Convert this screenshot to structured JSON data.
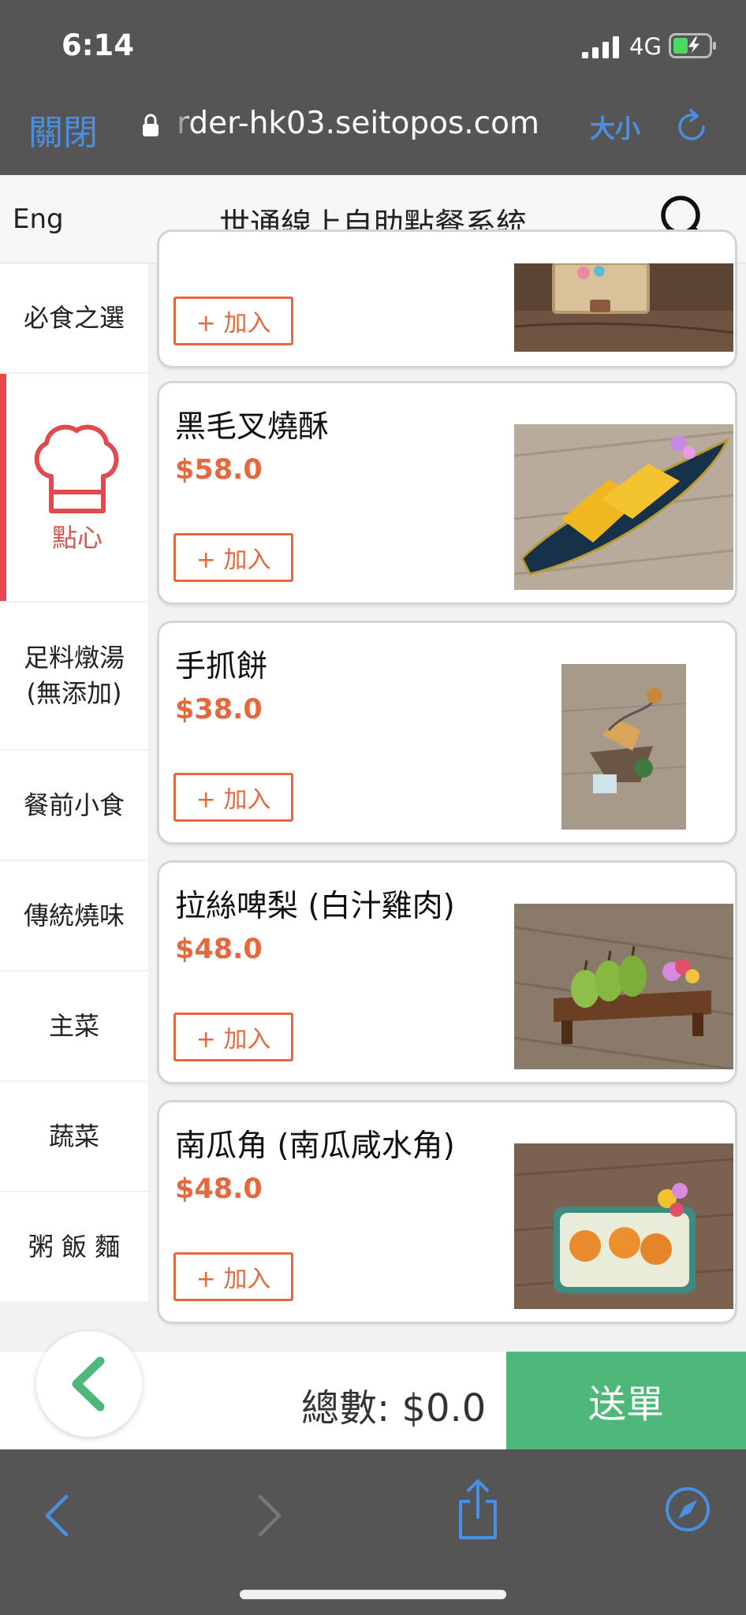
{
  "status_bar": {
    "time": "6:14",
    "network": "4G",
    "battery_icon": "battery-charging-icon",
    "signal_icon": "signal-icon"
  },
  "browser": {
    "close_label": "關閉",
    "url": "rder-hk03.seitopos.com",
    "text_size_label": "大小",
    "reload_icon": "reload-icon"
  },
  "header": {
    "language_toggle": "Eng",
    "title": "世通線上自助點餐系統",
    "search_icon": "search-icon"
  },
  "sidebar": {
    "categories": [
      {
        "label": "必食之選",
        "active": false
      },
      {
        "label": "點心",
        "active": true,
        "icon": "chef-hat-icon"
      },
      {
        "label": "足料燉湯\n(無添加)",
        "active": false
      },
      {
        "label": "餐前小食",
        "active": false
      },
      {
        "label": "傳統燒味",
        "active": false
      },
      {
        "label": "主菜",
        "active": false
      },
      {
        "label": "蔬菜",
        "active": false
      },
      {
        "label": "粥 飯 麵",
        "active": false
      }
    ]
  },
  "products": [
    {
      "name": "",
      "price": "",
      "add_label": "+ 加入"
    },
    {
      "name": "黑毛叉燒酥",
      "price": "$58.0",
      "add_label": "+ 加入"
    },
    {
      "name": "手抓餅",
      "price": "$38.0",
      "add_label": "+ 加入"
    },
    {
      "name": "拉絲啤梨 (白汁雞肉)",
      "price": "$48.0",
      "add_label": "+ 加入"
    },
    {
      "name": "南瓜角 (南瓜咸水角)",
      "price": "$48.0",
      "add_label": "+ 加入"
    }
  ],
  "footer": {
    "total_label": "總數: $0.0",
    "submit_label": "送單",
    "back_icon": "chevron-left-icon"
  },
  "toolbar": {
    "icons": [
      "back-arrow-icon",
      "forward-arrow-icon",
      "share-icon",
      "compass-icon"
    ]
  },
  "colors": {
    "accent_orange": "#e8673c",
    "active_red": "#e8454d",
    "submit_green": "#4eb87a",
    "browser_blue": "#4a90e2",
    "chrome_gray": "#555555"
  }
}
